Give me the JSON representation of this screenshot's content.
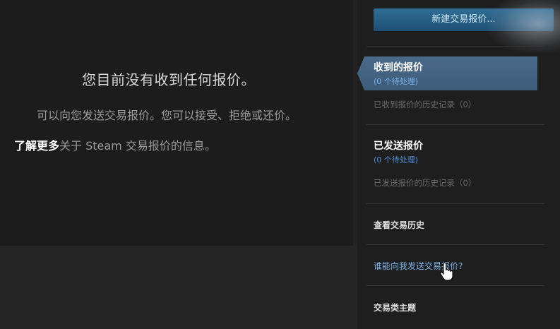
{
  "main": {
    "empty_title": "您目前没有收到任何报价。",
    "empty_desc": "可以向您发送交易报价。您可以接受、拒绝或还价。",
    "learn_more": "了解更多",
    "learn_rest": "关于 Steam 交易报价的信息。"
  },
  "sidebar": {
    "new_offer_button": "新建交易报价...",
    "received": {
      "title": "收到的报价",
      "pending": "(0 个待处理)",
      "history": "已收到报价的历史记录（0）"
    },
    "sent": {
      "title": "已发送报价",
      "pending": "(0 个待处理)",
      "history": "已发送报价的历史记录（0）"
    },
    "view_history": "查看交易历史",
    "who_can_send": "谁能向我发送交易报价?",
    "topics": "交易类主题"
  },
  "colors": {
    "accent_button": "#2f6e96",
    "active_tab": "#4a6a8a",
    "link_blue": "#7ab2e8"
  }
}
